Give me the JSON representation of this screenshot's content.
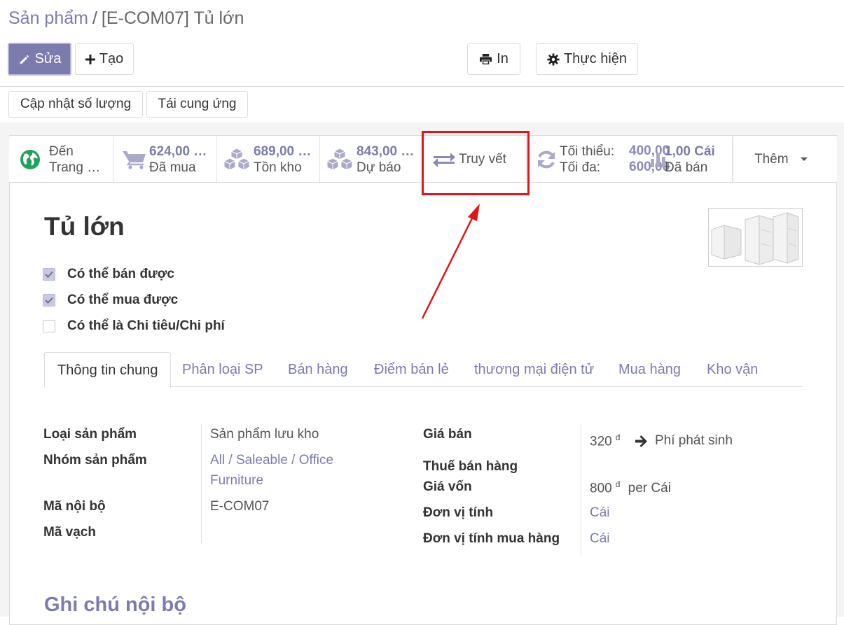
{
  "breadcrumb": {
    "parent": "Sản phẩm",
    "separator": "/",
    "current": "[E-COM07] Tủ lớn"
  },
  "toolbar": {
    "edit_label": "Sửa",
    "create_label": "Tạo",
    "print_label": "In",
    "action_label": "Thực hiện"
  },
  "header_buttons": {
    "update_qty_label": "Cập nhật số lượng",
    "replenish_label": "Tái cung ứng"
  },
  "smart_buttons": {
    "website": {
      "line1": "Đến",
      "line2": "Trang …"
    },
    "purchased": {
      "value": "624,00 …",
      "label": "Đã mua"
    },
    "on_hand": {
      "value": "689,00 …",
      "label": "Tồn kho"
    },
    "forecast": {
      "value": "843,00 …",
      "label": "Dự báo"
    },
    "traceability": {
      "label": "Truy vết"
    },
    "reordering": {
      "min_label": "Tối thiểu:",
      "max_label": "Tối đa:",
      "min_value": "400,00",
      "max_value": "600,00"
    },
    "sold": {
      "value": "1,00 Cái",
      "label": "Đã bán"
    },
    "more": {
      "label": "Thêm"
    }
  },
  "product": {
    "name": "Tủ lớn"
  },
  "options": {
    "can_be_sold": {
      "label": "Có thể bán được",
      "checked": true
    },
    "can_be_purchased": {
      "label": "Có thể mua được",
      "checked": true
    },
    "can_be_expensed": {
      "label": "Có thể là Chi tiêu/Chi phí",
      "checked": false
    }
  },
  "tabs": [
    {
      "label": "Thông tin chung",
      "active": true
    },
    {
      "label": "Phân loại SP"
    },
    {
      "label": "Bán hàng"
    },
    {
      "label": "Điểm bán lẻ"
    },
    {
      "label": "thương mại điện tử"
    },
    {
      "label": "Mua hàng"
    },
    {
      "label": "Kho vận"
    }
  ],
  "general_info": {
    "product_type": {
      "label": "Loại sản phẩm",
      "value": "Sản phẩm lưu kho"
    },
    "product_category": {
      "label": "Nhóm sản phẩm",
      "value_line1": "All / Saleable / Office",
      "value_line2": "Furniture"
    },
    "internal_ref": {
      "label": "Mã nội bộ",
      "value": "E-COM07"
    },
    "barcode": {
      "label": "Mã vạch",
      "value": ""
    },
    "sales_price": {
      "label": "Giá bán",
      "value": "320",
      "currency": "đ",
      "extra_price_label": "Phí phát sinh"
    },
    "customer_taxes": {
      "label": "Thuế bán hàng",
      "value": ""
    },
    "cost": {
      "label": "Giá vốn",
      "value": "800",
      "currency": "đ",
      "unit_text": "per Cái"
    },
    "uom": {
      "label": "Đơn vị tính",
      "value": "Cái"
    },
    "purchase_uom": {
      "label": "Đơn vị tính mua hàng",
      "value": "Cái"
    }
  },
  "internal_notes_title": "Ghi chú nội bộ",
  "colors": {
    "primary": "#7c7bad",
    "annotation": "#e0141a"
  }
}
